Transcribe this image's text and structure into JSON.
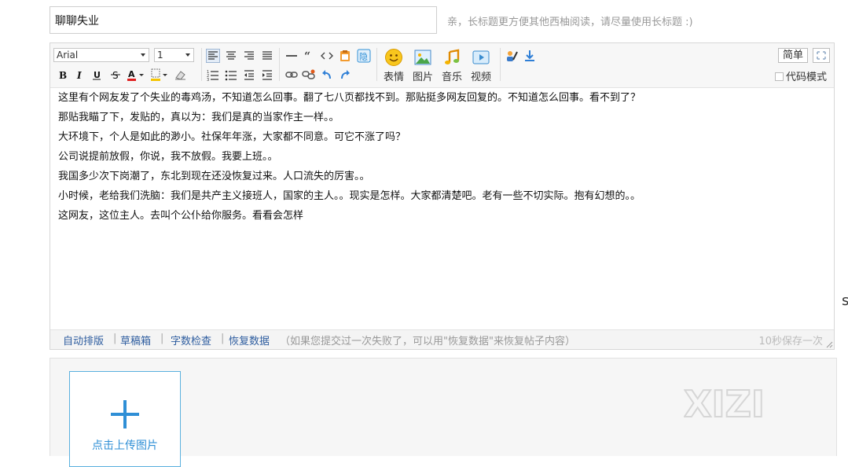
{
  "title_field": {
    "value": "聊聊失业",
    "hint": "亲，长标题更方便其他西柚阅读，请尽量使用长标题 :)"
  },
  "toolbar": {
    "font_family": "Arial",
    "font_size": "1",
    "media_buttons": [
      {
        "label": "表情",
        "icon": "smiley-icon"
      },
      {
        "label": "图片",
        "icon": "image-icon"
      },
      {
        "label": "音乐",
        "icon": "music-icon"
      },
      {
        "label": "视频",
        "icon": "video-icon"
      }
    ],
    "simple_label": "简单",
    "code_mode_label": "代码模式",
    "hide_glyph": "隐"
  },
  "post_body": {
    "lines": [
      "这里有个网友发了个失业的毒鸡汤，不知道怎么回事。翻了七八页都找不到。那贴挺多网友回复的。不知道怎么回事。看不到了？",
      "那贴我瞄了下，发贴的，真以为：我们是真的当家作主一样。。",
      "大环境下，个人是如此的渺小。社保年年涨，大家都不同意。可它不涨了吗？",
      "公司说提前放假，你说，我不放假。我要上班。。",
      "我国多少次下岗潮了，东北到现在还没恢复过来。人口流失的厉害。。",
      "小时候，老给我们洗脑：我们是共产主义接班人，国家的主人。。现实是怎样。大家都清楚吧。老有一些不切实际。抱有幻想的。。",
      "这网友，这位主人。去叫个公仆给你服务。看看会怎样"
    ]
  },
  "status_bar": {
    "auto_format": "自动排版",
    "drafts": "草稿箱",
    "word_check": "字数检查",
    "restore_data": "恢复数据",
    "note": "（如果您提交过一次失败了，可以用\"恢复数据\"来恢复帖子内容）",
    "autosave": "10秒保存一次"
  },
  "upload": {
    "label": "点击上传图片"
  },
  "watermark": {
    "text": "XIZI"
  },
  "colors": {
    "link": "#2e5d9f",
    "upload_accent": "#2f8fd6"
  }
}
